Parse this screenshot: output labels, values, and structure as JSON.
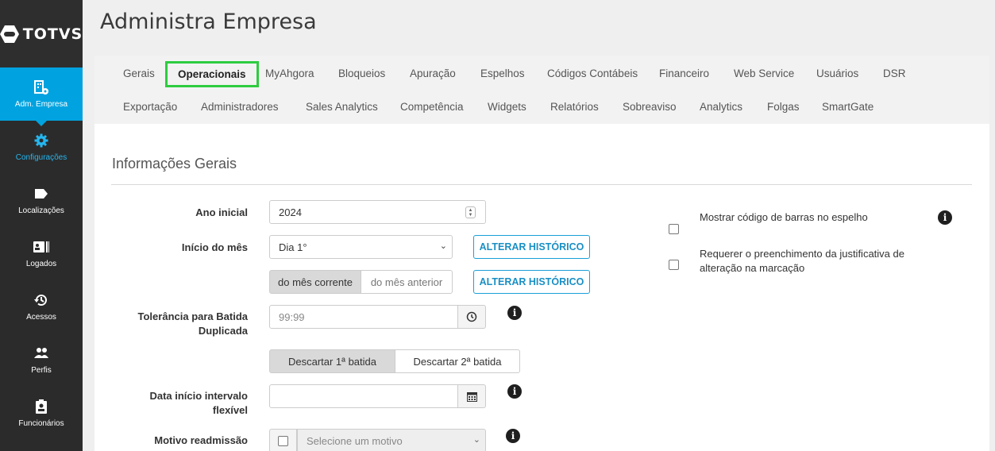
{
  "brand": {
    "name": "TOTVS",
    "logo_icon": "totvs-logo-mark"
  },
  "sidebar": {
    "items": [
      {
        "label": "Adm. Empresa",
        "icon": "building-gear-icon"
      },
      {
        "label": "Configurações",
        "icon": "gear-icon"
      },
      {
        "label": "Localizações",
        "icon": "tag-icon"
      },
      {
        "label": "Logados",
        "icon": "id-card-icon"
      },
      {
        "label": "Acessos",
        "icon": "history-icon"
      },
      {
        "label": "Perfis",
        "icon": "users-icon"
      },
      {
        "label": "Funcionários",
        "icon": "badge-icon"
      }
    ]
  },
  "header": {
    "title": "Administra Empresa"
  },
  "tabs": {
    "row1": [
      "Gerais",
      "Operacionais",
      "MyAhgora",
      "Bloqueios",
      "Apuração",
      "Espelhos",
      "Códigos Contábeis",
      "Financeiro",
      "Web Service",
      "Usuários",
      "DSR"
    ],
    "row2": [
      "Exportação",
      "Administradores",
      "Sales Analytics",
      "Competência",
      "Widgets",
      "Relatórios",
      "Sobreaviso",
      "Analytics",
      "Folgas",
      "SmartGate"
    ],
    "active": "Operacionais"
  },
  "section": {
    "title": "Informações Gerais"
  },
  "form": {
    "ano_inicial": {
      "label": "Ano inicial",
      "value": "2024"
    },
    "inicio_mes": {
      "label": "Início do mês",
      "value": "Dia 1°",
      "button": "ALTERAR HISTÓRICO"
    },
    "mes_toggle": {
      "options": [
        "do mês corrente",
        "do mês anterior"
      ],
      "selected": "do mês corrente",
      "button": "ALTERAR HISTÓRICO"
    },
    "tolerancia": {
      "label_line1": "Tolerância para Batida",
      "label_line2": "Duplicada",
      "placeholder": "99:99"
    },
    "descartar": {
      "options": [
        "Descartar 1ª batida",
        "Descartar 2ª batida"
      ],
      "selected": "Descartar 1ª batida"
    },
    "data_intervalo": {
      "label_line1": "Data início intervalo",
      "label_line2": "flexível",
      "value": ""
    },
    "motivo": {
      "label": "Motivo readmissão",
      "placeholder": "Selecione um motivo"
    }
  },
  "options_right": {
    "codigo_barras": {
      "label": "Mostrar código de barras no espelho",
      "checked": false
    },
    "justificativa": {
      "label_line1": "Requerer o preenchimento da justificativa de",
      "label_line2": "alteração na marcação",
      "checked": false
    }
  },
  "colors": {
    "accent": "#00a3e0",
    "active_tab_border": "#2ecc40",
    "sidebar_bg": "#2b2b2b"
  }
}
